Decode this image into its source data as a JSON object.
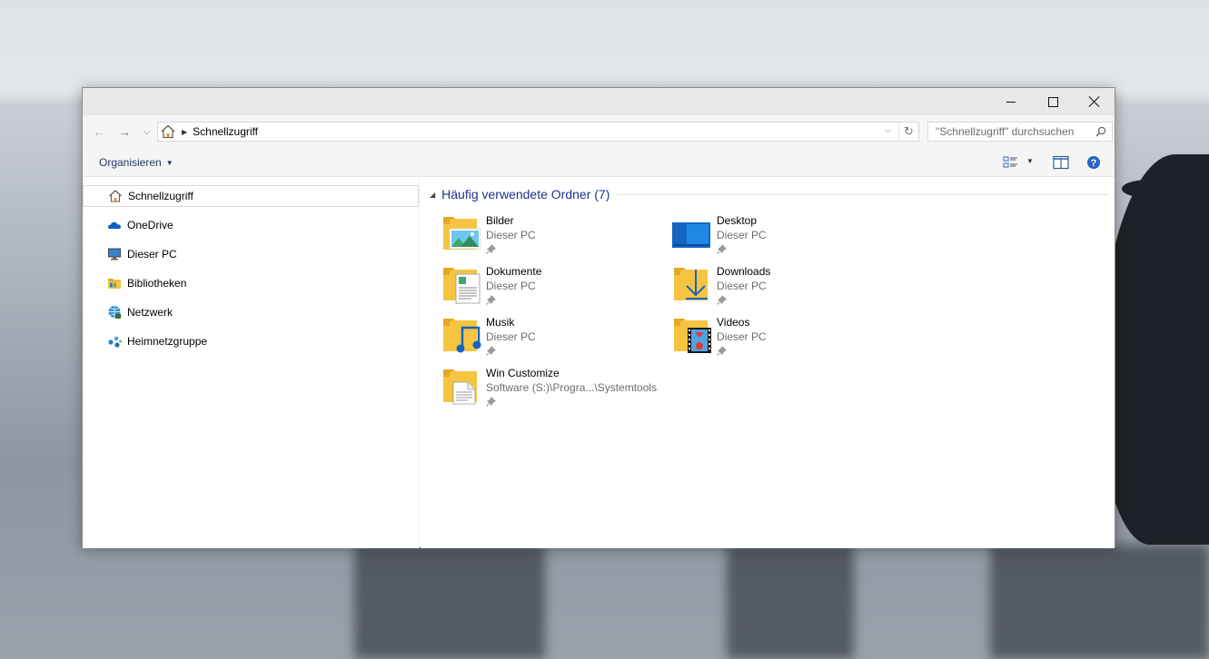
{
  "window": {
    "minimize_icon": "minimize-icon",
    "maximize_icon": "maximize-icon",
    "close_icon": "close-icon"
  },
  "navbar": {
    "back_icon": "arrow-left-icon",
    "forward_icon": "arrow-right-icon",
    "recent_icon": "chevron-down-icon",
    "address": {
      "location": "Schnellzugriff",
      "icon": "home-icon"
    },
    "search": {
      "placeholder": "\"Schnellzugriff\" durchsuchen"
    }
  },
  "toolbar": {
    "organize_label": "Organisieren"
  },
  "sidebar": {
    "items": [
      {
        "label": "Schnellzugriff",
        "icon": "home-icon",
        "selected": true
      },
      {
        "label": "OneDrive",
        "icon": "cloud-icon"
      },
      {
        "label": "Dieser PC",
        "icon": "computer-icon"
      },
      {
        "label": "Bibliotheken",
        "icon": "library-icon"
      },
      {
        "label": "Netzwerk",
        "icon": "network-icon"
      },
      {
        "label": "Heimnetzgruppe",
        "icon": "homegroup-icon"
      }
    ]
  },
  "main": {
    "group": {
      "title": "Häufig verwendete Ordner (7)"
    },
    "folders": [
      {
        "name": "Bilder",
        "location": "Dieser PC",
        "icon": "pictures-folder-icon"
      },
      {
        "name": "Desktop",
        "location": "Dieser PC",
        "icon": "desktop-folder-icon"
      },
      {
        "name": "Dokumente",
        "location": "Dieser PC",
        "icon": "documents-folder-icon"
      },
      {
        "name": "Downloads",
        "location": "Dieser PC",
        "icon": "downloads-folder-icon"
      },
      {
        "name": "Musik",
        "location": "Dieser PC",
        "icon": "music-folder-icon"
      },
      {
        "name": "Videos",
        "location": "Dieser PC",
        "icon": "videos-folder-icon"
      },
      {
        "name": "Win Customize",
        "location": "Software (S:)\\Progra...\\Systemtools",
        "icon": "folder-icon"
      }
    ]
  },
  "colors": {
    "accent": "#1e3287",
    "folder_yellow": "#f6c440",
    "folder_dark": "#e4a825",
    "link_blue": "#1e395b"
  }
}
